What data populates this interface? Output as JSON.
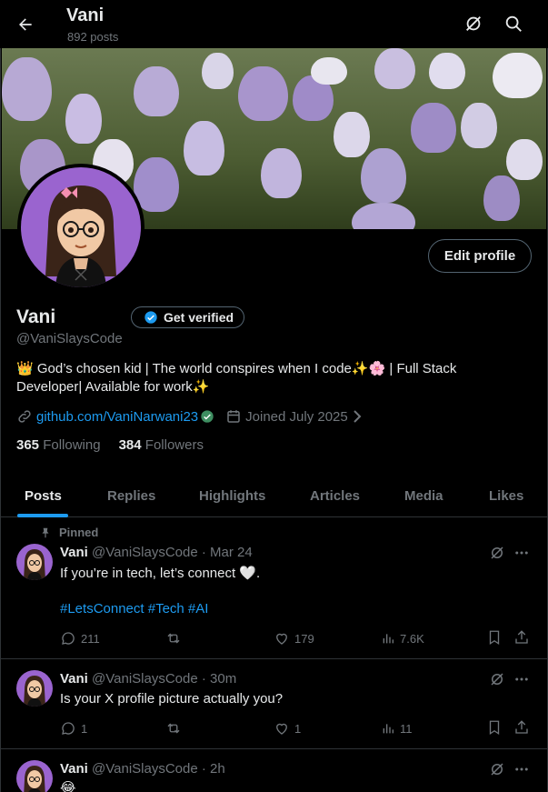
{
  "header": {
    "title": "Vani",
    "subtitle": "892 posts"
  },
  "profile": {
    "name": "Vani",
    "verify_label": "Get verified",
    "handle": "@VaniSlaysCode",
    "bio_line1": "👑 God’s chosen kid | The world conspires when I code✨🌸 | Full Stack",
    "bio_line2": "Developer| Available for work✨",
    "website": "github.com/VaniNarwani23",
    "joined": "Joined July 2025",
    "following_count": "365",
    "following_label": "Following",
    "followers_count": "384",
    "followers_label": "Followers",
    "edit_label": "Edit profile"
  },
  "tabs": [
    "Posts",
    "Replies",
    "Highlights",
    "Articles",
    "Media",
    "Likes"
  ],
  "posts": [
    {
      "pinned_label": "Pinned",
      "name": "Vani",
      "meta": "@VaniSlaysCode · Mar 24",
      "text": "If you’re in tech, let’s connect 🤍.",
      "tags": "#LetsConnect #Tech #AI",
      "replies": "211",
      "reposts": "",
      "likes": "179",
      "views": "7.6K"
    },
    {
      "name": "Vani",
      "meta": "@VaniSlaysCode · 30m",
      "text": "Is your X profile picture actually you?",
      "replies": "1",
      "reposts": "",
      "likes": "1",
      "views": "11"
    },
    {
      "name": "Vani",
      "meta": "@VaniSlaysCode · 2h",
      "text": "😂"
    }
  ],
  "colors": {
    "accent": "#1d9bf0",
    "muted": "#71767b",
    "text": "#e7e9ea",
    "border": "#2f3336"
  },
  "icons": [
    "back-arrow-icon",
    "grok-icon",
    "search-icon",
    "verified-badge-icon",
    "link-icon",
    "calendar-icon",
    "chevron-right-icon",
    "pin-icon",
    "reply-icon",
    "repost-icon",
    "like-icon",
    "views-icon",
    "bookmark-icon",
    "share-icon",
    "more-icon"
  ]
}
